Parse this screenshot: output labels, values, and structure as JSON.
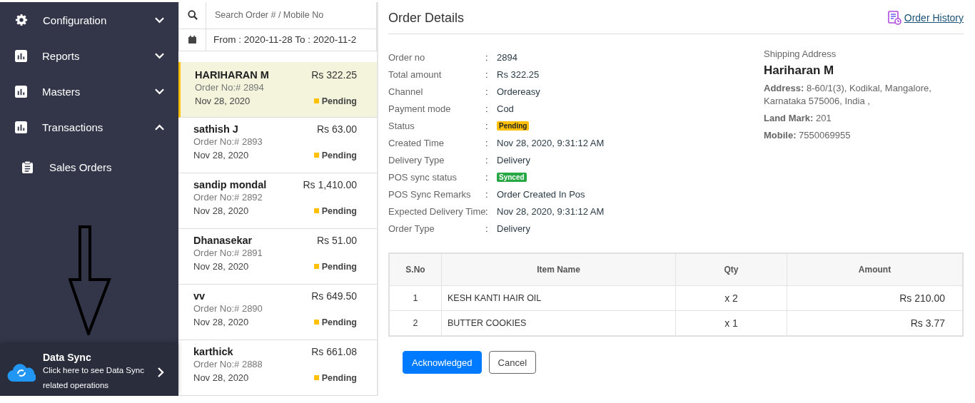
{
  "sidebar": {
    "items": [
      {
        "label": "Configuration",
        "expanded": false
      },
      {
        "label": "Reports",
        "expanded": false
      },
      {
        "label": "Masters",
        "expanded": false
      },
      {
        "label": "Transactions",
        "expanded": true,
        "children": [
          {
            "label": "Sales Orders"
          }
        ]
      }
    ],
    "data_sync": {
      "title": "Data Sync",
      "text": "Click here to see Data Sync related operations"
    }
  },
  "order_list": {
    "search": {
      "placeholder": "Search Order # / Mobile No"
    },
    "date_range": "From : 2020-11-28 To : 2020-11-2",
    "orders": [
      {
        "name": "HARIHARAN M",
        "amount": "Rs 322.25",
        "order_no": "Order No:# 2894",
        "date": "Nov 28, 2020",
        "status": "Pending",
        "color": "#ffc107",
        "selected": true
      },
      {
        "name": "sathish J",
        "amount": "Rs 63.00",
        "order_no": "Order No:# 2893",
        "date": "Nov 28, 2020",
        "status": "Pending",
        "color": "#ffc107",
        "selected": false
      },
      {
        "name": "sandip mondal",
        "amount": "Rs 1,410.00",
        "order_no": "Order No:# 2892",
        "date": "Nov 28, 2020",
        "status": "Pending",
        "color": "#ffc107",
        "selected": false
      },
      {
        "name": "Dhanasekar",
        "amount": "Rs 51.00",
        "order_no": "Order No:# 2891",
        "date": "Nov 28, 2020",
        "status": "Pending",
        "color": "#ffc107",
        "selected": false
      },
      {
        "name": "vv",
        "amount": "Rs 649.50",
        "order_no": "Order No:# 2890",
        "date": "Nov 28, 2020",
        "status": "Pending",
        "color": "#ffc107",
        "selected": false
      },
      {
        "name": "karthick",
        "amount": "Rs 661.08",
        "order_no": "Order No:# 2888",
        "date": "Nov 28, 2020",
        "status": "Pending",
        "color": "#ffc107",
        "selected": false
      }
    ]
  },
  "order_details": {
    "title": "Order Details",
    "history_link": "Order History",
    "separator": ":",
    "fields": [
      {
        "label": "Order no",
        "value": "2894",
        "kind": "text"
      },
      {
        "label": "Total amount",
        "value": "Rs 322.25",
        "kind": "text"
      },
      {
        "label": "Channel",
        "value": "Ordereasy",
        "kind": "text"
      },
      {
        "label": "Payment mode",
        "value": "Cod",
        "kind": "text"
      },
      {
        "label": "Status",
        "value": "Pending",
        "kind": "badge",
        "color": "#ffc107"
      },
      {
        "label": "Created Time",
        "value": "Nov 28, 2020, 9:31:12 AM",
        "kind": "text"
      },
      {
        "label": "Delivery Type",
        "value": "Delivery",
        "kind": "text"
      },
      {
        "label": "POS sync status",
        "value": "Synced",
        "kind": "badge",
        "color": "#28a745"
      },
      {
        "label": "POS Sync Remarks",
        "value": "Order Created In Pos",
        "kind": "text"
      },
      {
        "label": "Expected Delivery Time",
        "value": "Nov 28, 2020, 9:31:12 AM",
        "kind": "text"
      },
      {
        "label": "Order Type",
        "value": "Delivery",
        "kind": "text"
      }
    ],
    "shipping": {
      "heading": "Shipping Address",
      "name": "Hariharan M",
      "lines": [
        {
          "label": "Address:",
          "value": "8-60/1(3), Kodikal, Mangalore, Karnataka 575006, India ,"
        },
        {
          "label": "Land Mark:",
          "value": "201"
        },
        {
          "label": "Mobile:",
          "value": "7550069955"
        }
      ]
    },
    "table": {
      "columns": [
        "S.No",
        "Item Name",
        "Qty",
        "Amount"
      ],
      "rows": [
        [
          "1",
          "KESH KANTI HAIR OIL",
          "x 2",
          "Rs  210.00"
        ],
        [
          "2",
          "BUTTER COOKIES",
          "x 1",
          "Rs  3.77"
        ]
      ]
    },
    "buttons": [
      {
        "label": "Acknowledged",
        "kind": "primary"
      },
      {
        "label": "Cancel",
        "kind": "secondary"
      }
    ]
  }
}
